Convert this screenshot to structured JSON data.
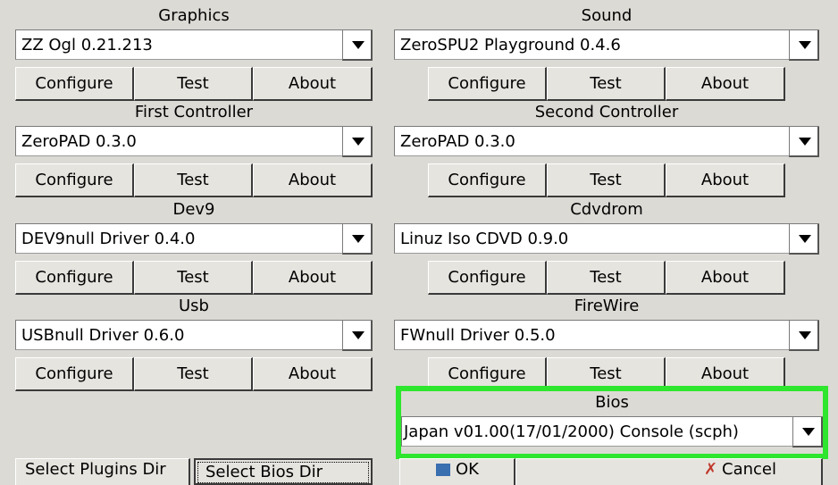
{
  "sections": {
    "graphics": {
      "label": "Graphics",
      "selected": "ZZ Ogl  0.21.213"
    },
    "sound": {
      "label": "Sound",
      "selected": "ZeroSPU2 Playground 0.4.6"
    },
    "first_controller": {
      "label": "First Controller",
      "selected": "ZeroPAD 0.3.0"
    },
    "second_controller": {
      "label": "Second Controller",
      "selected": "ZeroPAD 0.3.0"
    },
    "dev9": {
      "label": "Dev9",
      "selected": "DEV9null Driver 0.4.0"
    },
    "cdvdrom": {
      "label": "Cdvdrom",
      "selected": "Linuz Iso CDVD  0.9.0"
    },
    "usb": {
      "label": "Usb",
      "selected": "USBnull Driver 0.6.0"
    },
    "firewire": {
      "label": "FireWire",
      "selected": "FWnull Driver 0.5.0"
    },
    "bios": {
      "label": "Bios",
      "selected": "Japan  v01.00(17/01/2000) Console (scph)"
    }
  },
  "buttons": {
    "configure": "Configure",
    "test": "Test",
    "about": "About"
  },
  "bottom": {
    "select_plugins_dir": "Select Plugins Dir",
    "select_bios_dir": "Select Bios Dir",
    "ok": "OK",
    "cancel": "Cancel"
  },
  "colors": {
    "highlight": "#2ee62e",
    "background": "#dcdad5"
  },
  "icons": {
    "combo_arrow": "chevron-down-icon",
    "ok": "ok-icon",
    "cancel": "cancel-icon"
  }
}
